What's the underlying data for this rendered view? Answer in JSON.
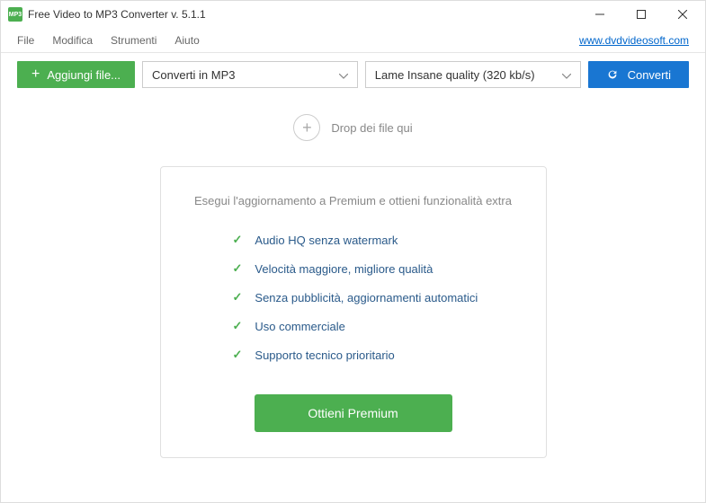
{
  "window": {
    "title": "Free Video to MP3 Converter v. 5.1.1",
    "icon_label": "MP3"
  },
  "menu": {
    "items": [
      "File",
      "Modifica",
      "Strumenti",
      "Aiuto"
    ],
    "link": "www.dvdvideosoft.com"
  },
  "toolbar": {
    "add_label": "Aggiungi file...",
    "format_selected": "Converti in MP3",
    "quality_selected": "Lame Insane quality (320 kb/s)",
    "convert_label": "Converti"
  },
  "drop": {
    "label": "Drop dei file qui"
  },
  "premium": {
    "title": "Esegui l'aggiornamento a Premium e ottieni funzionalità extra",
    "features": [
      "Audio HQ senza watermark",
      "Velocità maggiore, migliore qualità",
      "Senza pubblicità, aggiornamenti automatici",
      "Uso commerciale",
      "Supporto tecnico prioritario"
    ],
    "button": "Ottieni Premium"
  }
}
